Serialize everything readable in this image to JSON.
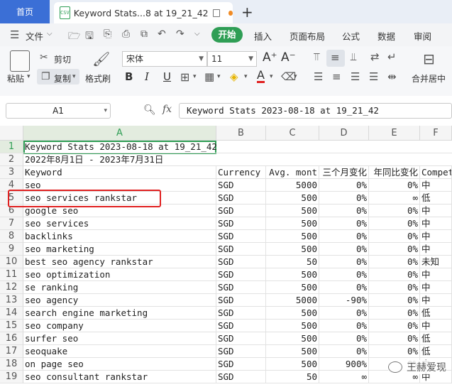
{
  "tabs": {
    "home": "首页",
    "doc_title": "Keyword Stats...8 at 19_21_42",
    "doc_icon": "csv-file-icon",
    "new_tab": "+"
  },
  "menu": {
    "file": "文件",
    "items": [
      "开始",
      "插入",
      "页面布局",
      "公式",
      "数据",
      "审阅"
    ]
  },
  "ribbon": {
    "paste": "粘贴",
    "cut": "剪切",
    "copy": "复制",
    "format_painter": "格式刷",
    "font_name": "宋体",
    "font_size": "11",
    "merge_center": "合并居中",
    "bold": "B",
    "italic": "I",
    "underline": "U",
    "font_color": "A"
  },
  "formula_bar": {
    "cell_ref": "A1",
    "fx": "fx",
    "content": "Keyword Stats 2023-08-18 at 19_21_42"
  },
  "columns": [
    "A",
    "B",
    "C",
    "D",
    "E",
    "F"
  ],
  "rows": [
    {
      "n": "1",
      "a": "Keyword Stats 2023-08-18 at 19_21_42",
      "b": "",
      "c": "",
      "d": "",
      "e": "",
      "f": ""
    },
    {
      "n": "2",
      "a": "2022年8月1日 - 2023年7月31日",
      "b": "",
      "c": "",
      "d": "",
      "e": "",
      "f": ""
    },
    {
      "n": "3",
      "a": "Keyword",
      "b": "Currency",
      "c": "Avg. mont",
      "d": "三个月变化",
      "e": "年同比变化",
      "f": "Compet"
    },
    {
      "n": "4",
      "a": "seo",
      "b": "SGD",
      "c": "5000",
      "d": "0%",
      "e": "0%",
      "f": "中"
    },
    {
      "n": "5",
      "a": "seo services rankstar",
      "b": "SGD",
      "c": "500",
      "d": "0%",
      "e": "∞",
      "f": "低"
    },
    {
      "n": "6",
      "a": "google seo",
      "b": "SGD",
      "c": "500",
      "d": "0%",
      "e": "0%",
      "f": "中"
    },
    {
      "n": "7",
      "a": "seo services",
      "b": "SGD",
      "c": "500",
      "d": "0%",
      "e": "0%",
      "f": "中"
    },
    {
      "n": "8",
      "a": "backlinks",
      "b": "SGD",
      "c": "500",
      "d": "0%",
      "e": "0%",
      "f": "中"
    },
    {
      "n": "9",
      "a": "seo marketing",
      "b": "SGD",
      "c": "500",
      "d": "0%",
      "e": "0%",
      "f": "中"
    },
    {
      "n": "10",
      "a": "best seo agency rankstar",
      "b": "SGD",
      "c": "50",
      "d": "0%",
      "e": "0%",
      "f": "未知"
    },
    {
      "n": "11",
      "a": "seo optimization",
      "b": "SGD",
      "c": "500",
      "d": "0%",
      "e": "0%",
      "f": "中"
    },
    {
      "n": "12",
      "a": "se ranking",
      "b": "SGD",
      "c": "500",
      "d": "0%",
      "e": "0%",
      "f": "中"
    },
    {
      "n": "13",
      "a": "seo agency",
      "b": "SGD",
      "c": "5000",
      "d": "-90%",
      "e": "0%",
      "f": "中"
    },
    {
      "n": "14",
      "a": "search engine marketing",
      "b": "SGD",
      "c": "500",
      "d": "0%",
      "e": "0%",
      "f": "低"
    },
    {
      "n": "15",
      "a": "seo company",
      "b": "SGD",
      "c": "500",
      "d": "0%",
      "e": "0%",
      "f": "中"
    },
    {
      "n": "16",
      "a": "surfer seo",
      "b": "SGD",
      "c": "500",
      "d": "0%",
      "e": "0%",
      "f": "低"
    },
    {
      "n": "17",
      "a": "seoquake",
      "b": "SGD",
      "c": "500",
      "d": "0%",
      "e": "0%",
      "f": "低"
    },
    {
      "n": "18",
      "a": "on page seo",
      "b": "SGD",
      "c": "500",
      "d": "900%",
      "e": "0%",
      "f": "中"
    },
    {
      "n": "19",
      "a": "seo consultant rankstar",
      "b": "SGD",
      "c": "50",
      "d": "∞",
      "e": "∞",
      "f": "中"
    }
  ],
  "watermark": "王赫爱现"
}
